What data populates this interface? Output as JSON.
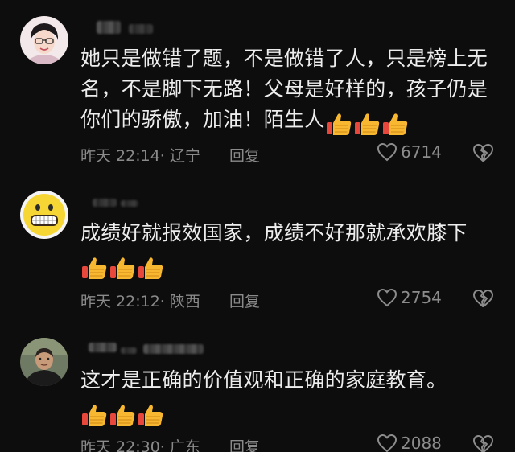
{
  "comments": [
    {
      "text": "她只是做错了题，不是做错了人，只是榜上无名，不是脚下无路！父母是好样的，孩子仍是你们的骄傲，加油！陌生人",
      "time": "昨天 22:14",
      "location": "· 辽宁",
      "reply_label": "回复",
      "likes": "6714",
      "thumbs_count": 3
    },
    {
      "text": "成绩好就报效国家，成绩不好那就承欢膝下",
      "time": "昨天 22:12",
      "location": "· 陕西",
      "reply_label": "回复",
      "likes": "2754",
      "thumbs_count": 3
    },
    {
      "text": "这才是正确的价值观和正确的家庭教育。",
      "time": "昨天 22:30",
      "location": "· 广东",
      "reply_label": "回复",
      "likes": "2088",
      "thumbs_count": 3
    }
  ],
  "icons": {
    "like": "heart-outline-icon",
    "dislike": "broken-heart-icon",
    "emoji": "thumbs-up-emoji-icon"
  },
  "colors": {
    "background": "#0d0d0d",
    "text": "#ededed",
    "meta": "#8a8a8a",
    "thumb": "#f7b731"
  }
}
